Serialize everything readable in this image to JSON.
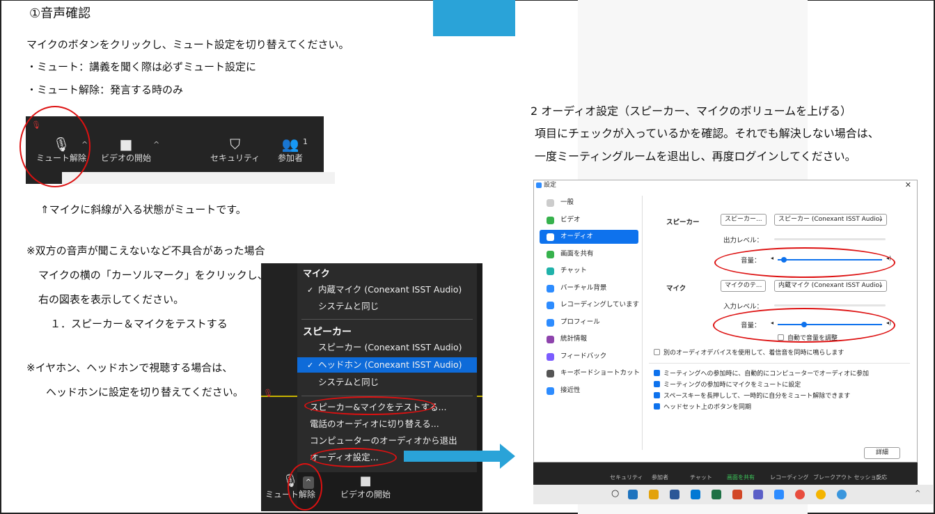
{
  "left": {
    "title": "①音声確認",
    "line1": "マイクのボタンをクリックし、ミュート設定を切り替えてください。",
    "line2": "・ミュート：講義を聞く際は必ずミュート設定に",
    "line3": "・ミュート解除：発言する時のみ",
    "caption": "⇑マイクに斜線が入る状態がミュートです。",
    "note1": "※双方の音声が聞こえないなど不具合があった場合",
    "note2": "マイクの横の「カーソルマーク」をクリックし、",
    "note3": "右の図表を表示してください。",
    "note4": "１．スピーカー＆マイクをテストする",
    "note5": "※イヤホン、ヘッドホンで視聴する場合は、",
    "note6": "ヘッドホンに設定を切り替えてください。"
  },
  "toolbar1": {
    "unmute": "ミュート解除",
    "video": "ビデオの開始",
    "security": "セキュリティ",
    "participants": "参加者",
    "participant_count": "1"
  },
  "dropdown": {
    "mic_header": "マイク",
    "mic_item1": "内蔵マイク (Conexant ISST Audio)",
    "mic_item2": "システムと同じ",
    "spk_header": "スピーカー",
    "spk_item1": "スピーカー (Conexant ISST Audio)",
    "spk_item2": "ヘッドホン (Conexant ISST Audio)",
    "spk_item3": "システムと同じ",
    "act1": "スピーカー&マイクをテストする...",
    "act2": "電話のオーディオに切り替える...",
    "act3": "コンピューターのオーディオから退出",
    "act4": "オーディオ設定...",
    "unmute": "ミュート解除",
    "video": "ビデオの開始"
  },
  "right": {
    "title": "2 オーディオ設定（スピーカー、マイクのボリュームを上げる）",
    "line1": "項目にチェックが入っているかを確認。それでも解決しない場合は、",
    "line2": "一度ミーティングルームを退出し、再度ログインしてください。"
  },
  "settings": {
    "window_title": "設定",
    "sidebar": [
      "一般",
      "ビデオ",
      "オーディオ",
      "画面を共有",
      "チャット",
      "バーチャル背景",
      "レコーディングしています",
      "プロフィール",
      "統計情報",
      "フィードバック",
      "キーボードショートカット",
      "接近性"
    ],
    "sidebar_colors": [
      "#cccccc",
      "#37b24d",
      "#0e72ed",
      "#37b24d",
      "#20b2aa",
      "#2d8cff",
      "#2d8cff",
      "#2d8cff",
      "#8e44ad",
      "#7b5cff",
      "#555555",
      "#2d8cff"
    ],
    "speaker_label": "スピーカー",
    "speaker_test": "スピーカー...",
    "speaker_device": "スピーカー (Conexant ISST Audio)",
    "output_level": "出力レベル：",
    "volume": "音量：",
    "mic_label": "マイク",
    "mic_test": "マイクのテ...",
    "mic_device": "内蔵マイク (Conexant ISST Audio)",
    "input_level": "入力レベル：",
    "auto_adjust": "自動で音量を調整",
    "separate_device": "別のオーディオデバイスを使用して、着信音を同時に鳴らします",
    "opt1": "ミーティングへの参加時に、自動的にコンピューターでオーディオに参加",
    "opt2": "ミーティングの参加時にマイクをミュートに設定",
    "opt3": "スペースキーを長押しして、一時的に自分をミュート解除できます",
    "opt4": "ヘッドセット上のボタンを同期",
    "detail": "詳細"
  },
  "toolbar2": [
    "セキュリティ",
    "参加者",
    "チャット",
    "画面を共有",
    "レコーディング",
    "ブレークアウト セッション",
    "反応"
  ],
  "colors": {
    "accent": "#2aa3d8",
    "zoom_blue": "#0e72ed",
    "circle": "#dd1111"
  }
}
